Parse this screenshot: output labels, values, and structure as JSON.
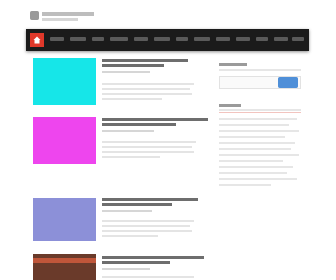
{
  "header": {
    "logo_icon": "site-logo-icon"
  },
  "navbar": {
    "home_icon": "home-icon",
    "accent_color": "#e0382a",
    "background_color": "#1b1b1b"
  },
  "posts": [
    {
      "thumbnail_color": "#16e6e8"
    },
    {
      "thumbnail_color": "#ee45ee"
    },
    {
      "thumbnail_color": "#8c90d8"
    },
    {
      "thumbnail_color": "#6a3a2a"
    }
  ],
  "sidebar": {
    "search_button_color": "#4f8fd8"
  }
}
